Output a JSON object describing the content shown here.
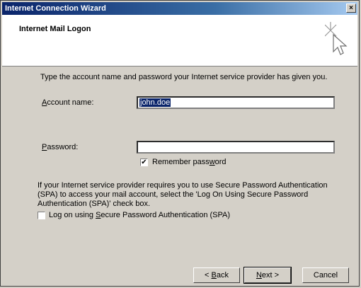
{
  "window": {
    "title": "Internet Connection Wizard",
    "close_glyph": "×"
  },
  "header": {
    "title": "Internet Mail Logon"
  },
  "intro": "Type the account name and password your Internet service provider has given you.",
  "account": {
    "label_pre": "",
    "label_u": "A",
    "label_post": "ccount name:",
    "value": "john.doe"
  },
  "password": {
    "label_pre": "",
    "label_u": "P",
    "label_post": "assword:",
    "value": ""
  },
  "remember": {
    "label_pre": "Remember pass",
    "label_u": "w",
    "label_post": "ord",
    "checked": "✔"
  },
  "spa_note": "If your Internet service provider requires you to use Secure Password Authentication (SPA) to access your mail account, select the 'Log On Using Secure Password Authentication (SPA)' check box.",
  "spa": {
    "label_pre": "Log on using ",
    "label_u": "S",
    "label_post": "ecure Password Authentication (SPA)",
    "checked": ""
  },
  "buttons": {
    "back": {
      "pre": "< ",
      "u": "B",
      "post": "ack"
    },
    "next": {
      "pre": "",
      "u": "N",
      "post": "ext >"
    },
    "cancel": "Cancel"
  }
}
